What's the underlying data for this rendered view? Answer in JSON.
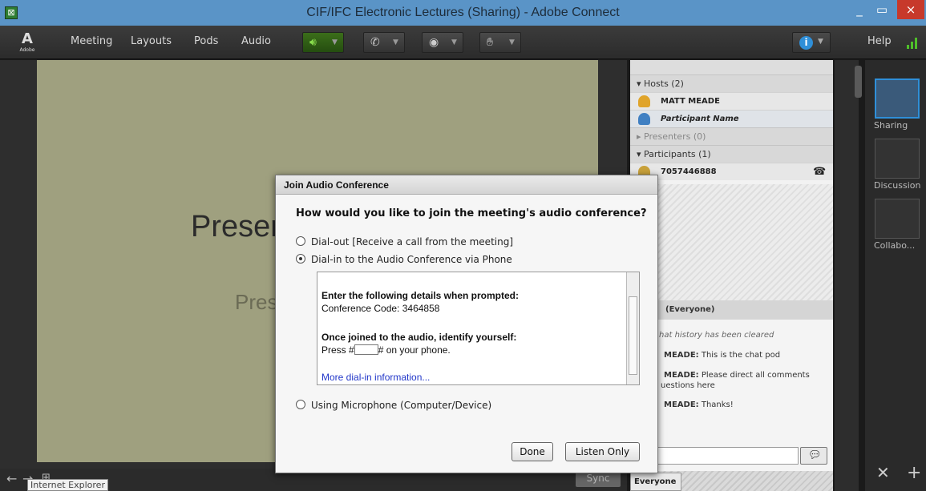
{
  "window": {
    "title": "CIF/IFC Electronic Lectures (Sharing) - Adobe Connect",
    "app_icon": "connect-app-icon",
    "minimize": "_",
    "maximize": "▭",
    "close": "×"
  },
  "menubar": {
    "logo_mark": "A",
    "logo_text": "Adobe",
    "items": [
      "Meeting",
      "Layouts",
      "Pods",
      "Audio"
    ],
    "help": "Help",
    "accent": "#3b6e1a"
  },
  "stage": {
    "slide_title": "Preser",
    "slide_sub": "Pres",
    "sync": "Sync",
    "tooltip": "Internet Explorer"
  },
  "attendees": {
    "hosts_header": "Hosts (2)",
    "hosts": [
      "MATT MEADE",
      "Participant Name"
    ],
    "presenters_header": "Presenters (0)",
    "participants_header": "Participants (1)",
    "participants": [
      "7057446888"
    ]
  },
  "chat": {
    "header": "(Everyone)",
    "messages": [
      {
        "author": "",
        "text": "hat history has been cleared"
      },
      {
        "author": "MEADE:",
        "text": " This is the chat pod"
      },
      {
        "author": "MEADE:",
        "text": " Please direct all comments"
      },
      {
        "author": "",
        "text": "uestions here"
      },
      {
        "author": "MEADE:",
        "text": " Thanks!"
      }
    ],
    "tab": "Everyone"
  },
  "layouts": {
    "items": [
      "Sharing",
      "Discussion",
      "Collabo..."
    ]
  },
  "dialog": {
    "title": "Join Audio Conference",
    "question": "How would you like to join the meeting's audio conference?",
    "options": [
      {
        "label": "Dial-out [Receive a call from the meeting]",
        "selected": false
      },
      {
        "label": "Dial-in to the Audio Conference via Phone",
        "selected": true
      },
      {
        "label": "Using Microphone (Computer/Device)",
        "selected": false
      }
    ],
    "info_heading1": "Enter the following details when prompted:",
    "conference_code_line": "Conference Code: 3464858",
    "info_heading2": "Once joined to the audio, identify yourself:",
    "press_prefix": "Press #",
    "press_suffix": "# on your phone.",
    "more_link": "More dial-in information...",
    "done": "Done",
    "listen_only": "Listen Only"
  }
}
